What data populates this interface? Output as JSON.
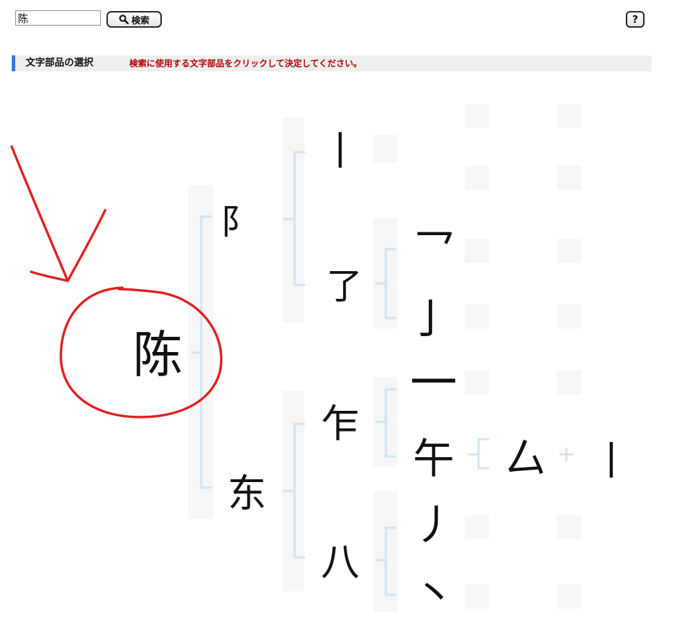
{
  "search": {
    "value": "陈",
    "button_label": "検索"
  },
  "help": {
    "label": "?"
  },
  "section": {
    "title": "文字部品の選択",
    "instruction": "検索に使用する文字部品をクリックして決定してください。"
  },
  "tree": {
    "root": "陈",
    "components": [
      "阝",
      "丨",
      "了",
      "乛",
      "亅",
      "东",
      "乍",
      "一",
      "午",
      "厶",
      "丨",
      "八",
      "丿",
      "丶"
    ]
  },
  "annotation": {
    "color": "#e02020"
  },
  "colors": {
    "accent": "#3778d7",
    "bracket": "#d3e2f2",
    "instruction_text": "#b00000"
  }
}
